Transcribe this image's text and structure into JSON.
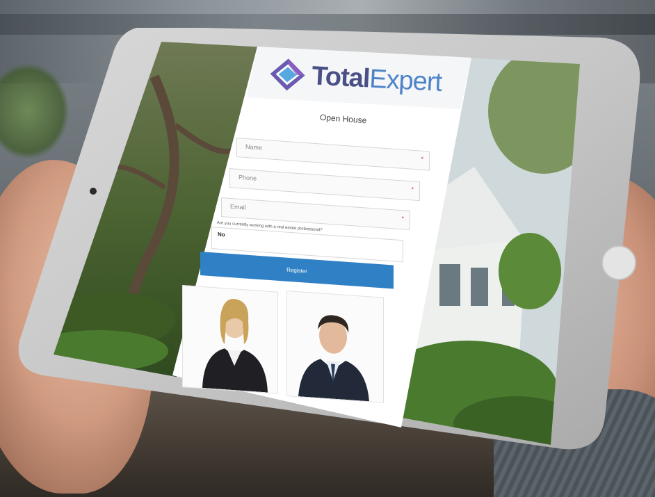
{
  "brand": {
    "name_part1": "Total",
    "name_part2": "Expert",
    "colors": {
      "total": "#4a4f87",
      "expert": "#4f83c8",
      "logo_outer": "#6b5bb0",
      "logo_inner": "#58a8e0"
    }
  },
  "form": {
    "title": "Open House",
    "name_placeholder": "Name",
    "phone_placeholder": "Phone",
    "email_placeholder": "Email",
    "required_marker": "*",
    "question": "Are you currently working with a real estate professional?",
    "answer": "No",
    "register_label": "Register",
    "register_color": "#2f80c4"
  },
  "agents": [
    {
      "name": "female-agent"
    },
    {
      "name": "male-agent"
    }
  ]
}
